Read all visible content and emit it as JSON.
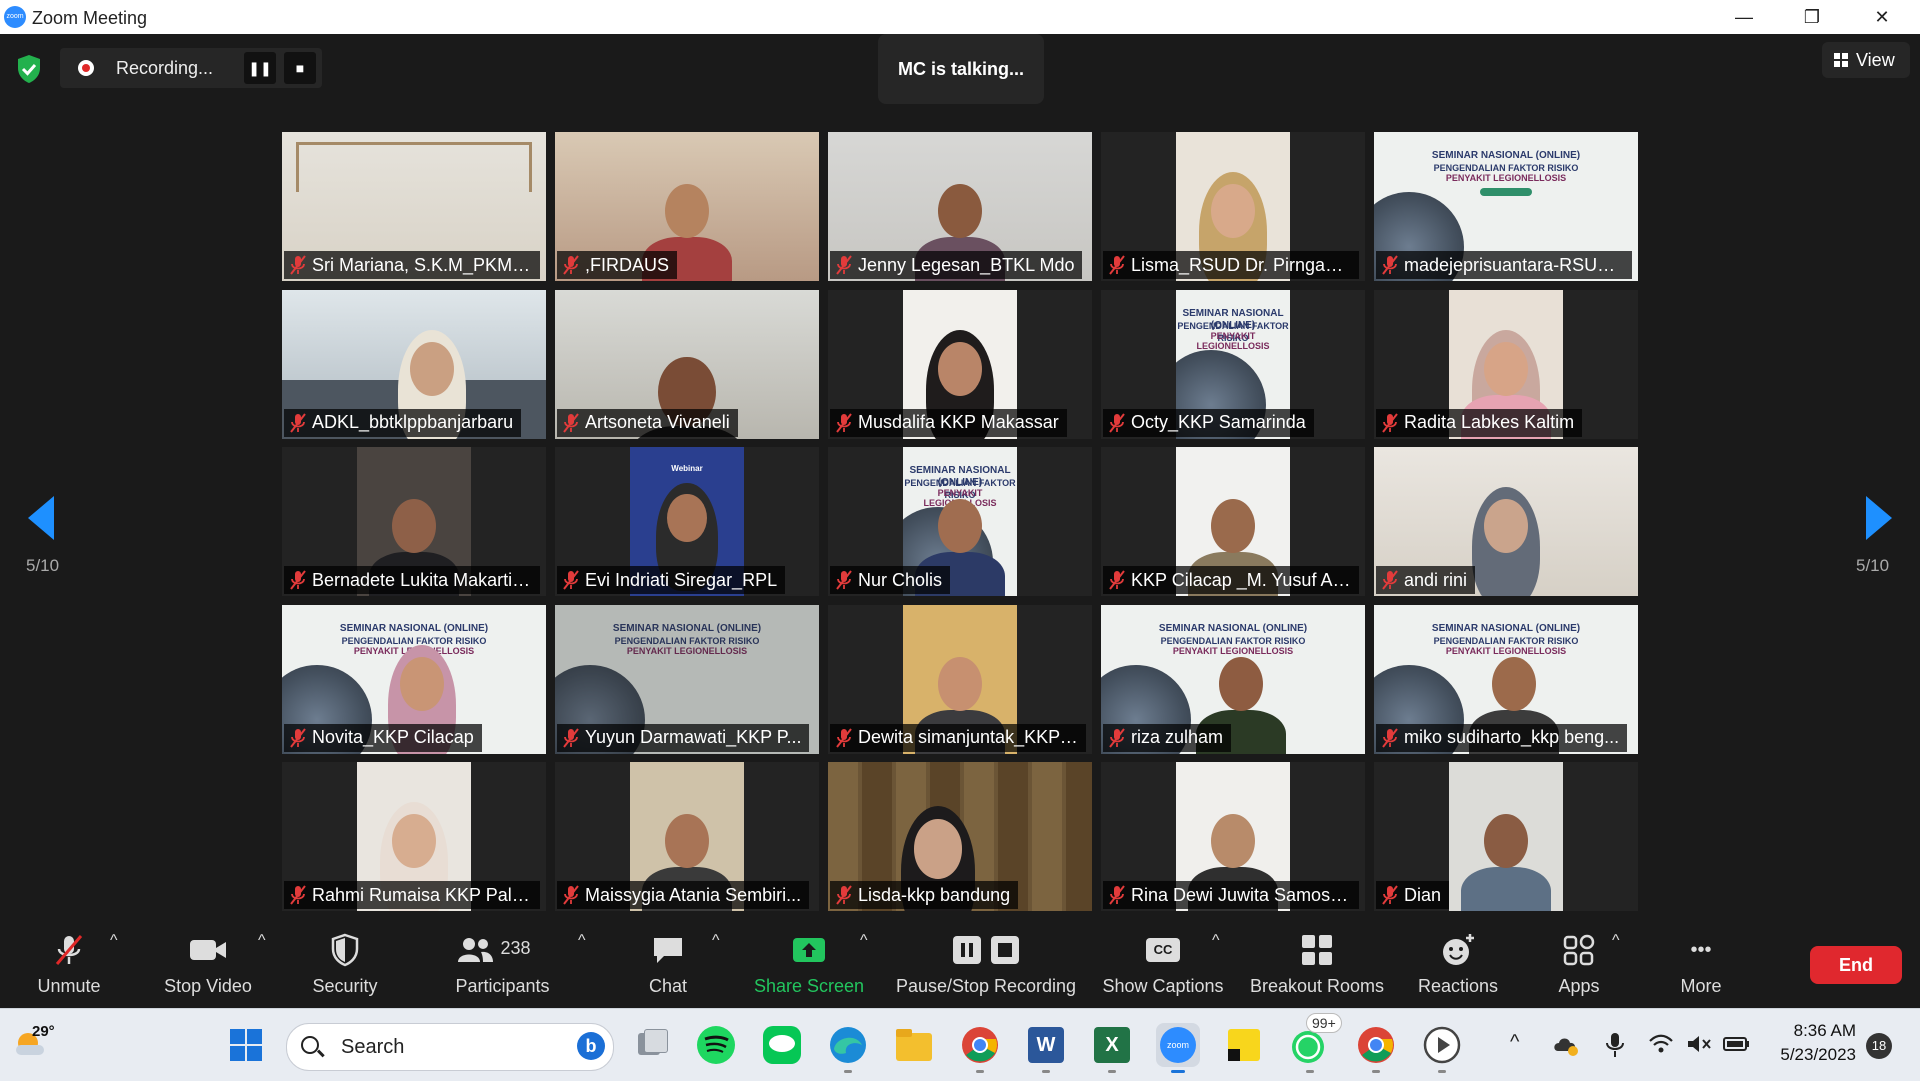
{
  "window": {
    "title": "Zoom Meeting",
    "app_icon_text": "zoom",
    "minimize": "—",
    "restore": "❐",
    "close": "✕"
  },
  "header": {
    "recording_label": "Recording...",
    "pause_symbol": "❚❚",
    "stop_symbol": "■",
    "talking_label": "MC is talking...",
    "view_label": "View"
  },
  "pagination": {
    "left": "5/10",
    "right": "5/10"
  },
  "slide_text": {
    "title1": "SEMINAR NASIONAL (ONLINE)",
    "title2": "PENGENDALIAN FAKTOR RISIKO",
    "title3": "PENYAKIT LEGIONELLOSIS",
    "webinar": "Webinar"
  },
  "participants": [
    {
      "name": "Sri Mariana, S.K.M_PKM S..."
    },
    {
      "name": ",FIRDAUS"
    },
    {
      "name": "Jenny Legesan_BTKL Mdo"
    },
    {
      "name": "Lisma_RSUD Dr. Pirngadi ..."
    },
    {
      "name": "madejeprisuantara-RSUD..."
    },
    {
      "name": "ADKL_bbtklppbanjarbaru"
    },
    {
      "name": "Artsoneta Vivaneli"
    },
    {
      "name": "Musdalifa KKP Makassar"
    },
    {
      "name": "Octy_KKP Samarinda"
    },
    {
      "name": "Radita Labkes Kaltim"
    },
    {
      "name": "Bernadete Lukita Makarti,..."
    },
    {
      "name": "Evi Indriati Siregar_RPL"
    },
    {
      "name": "Nur Cholis"
    },
    {
      "name": "KKP Cilacap _M. Yusuf Ar..."
    },
    {
      "name": "andi rini"
    },
    {
      "name": "Novita_KKP Cilacap"
    },
    {
      "name": "Yuyun Darmawati_KKP P..."
    },
    {
      "name": "Dewita simanjuntak_KKP ..."
    },
    {
      "name": "riza zulham"
    },
    {
      "name": "miko sudiharto_kkp beng..."
    },
    {
      "name": "Rahmi Rumaisa KKP Pala..."
    },
    {
      "name": "Maissygia Atania Sembiri..."
    },
    {
      "name": "Lisda-kkp bandung"
    },
    {
      "name": "Rina Dewi Juwita Samosir..."
    },
    {
      "name": "Dian"
    }
  ],
  "toolbar": {
    "unmute": "Unmute",
    "stop_video": "Stop Video",
    "security": "Security",
    "participants": "Participants",
    "participants_count": "238",
    "chat": "Chat",
    "share_screen": "Share Screen",
    "pause_stop_recording": "Pause/Stop Recording",
    "show_captions": "Show Captions",
    "captions_icon_text": "CC",
    "breakout_rooms": "Breakout Rooms",
    "reactions": "Reactions",
    "apps": "Apps",
    "more": "More",
    "more_symbol": "•••",
    "end": "End",
    "caret": "^",
    "share_color": "#22c55e",
    "end_color": "#e0282e"
  },
  "taskbar": {
    "temperature": "29°",
    "search_placeholder": "Search",
    "bing_letter": "b",
    "whatsapp_badge": "99+",
    "time": "8:36 AM",
    "date": "5/23/2023",
    "notifications": "18",
    "word_letter": "W",
    "excel_letter": "X",
    "zoom_label": "zoom",
    "tray_chevron": "^"
  }
}
